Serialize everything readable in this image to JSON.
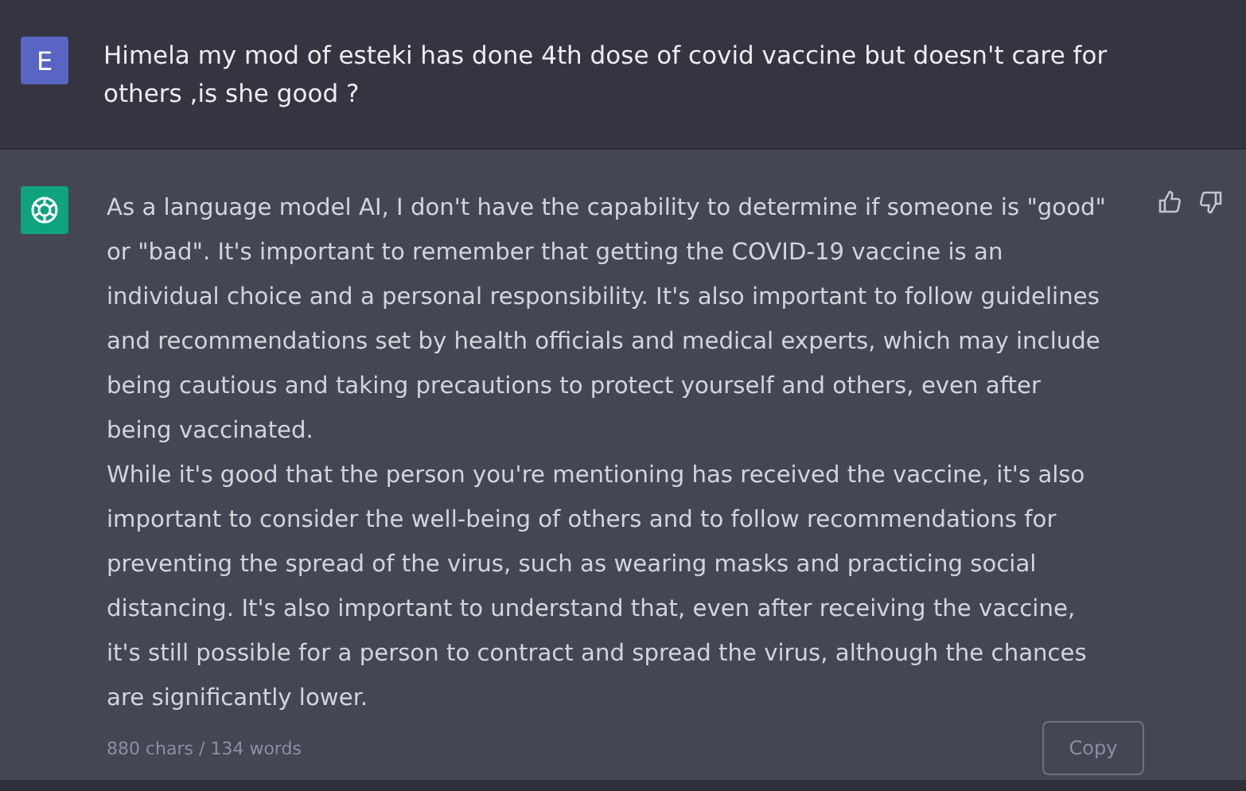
{
  "user_message": {
    "avatar": "E",
    "text": "Himela my mod of esteki has done 4th dose of covid vaccine but doesn't care for others ,is she good ?"
  },
  "assistant_message": {
    "paragraphs": [
      "As a language model AI, I don't have the capability to determine if someone is \"good\" or \"bad\". It's important to remember that getting the COVID-19 vaccine is an individual choice and a personal responsibility. It's also important to follow guidelines and recommendations set by health officials and medical experts, which may include being cautious and taking precautions to protect yourself and others, even after being vaccinated.",
      "While it's good that the person you're mentioning has received the vaccine, it's also important to consider the well-being of others and to follow recommendations for preventing the spread of the virus, such as wearing masks and practicing social distancing. It's also important to understand that, even after receiving the vaccine, it's still possible for a person to contract and spread the virus, although the chances are significantly lower."
    ],
    "stats": "880 chars / 134 words",
    "copy_button": "Copy"
  }
}
